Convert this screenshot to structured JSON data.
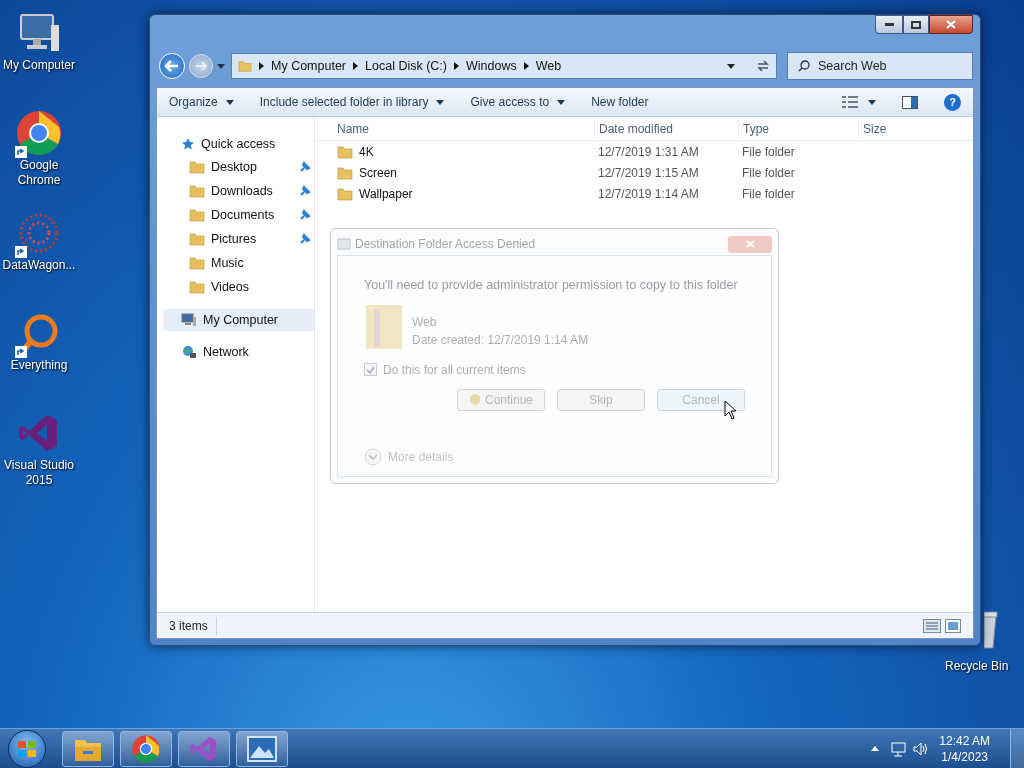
{
  "desktop_icons": [
    {
      "label": "My Computer",
      "kind": "computer",
      "shortcut": false
    },
    {
      "label": "Google Chrome",
      "kind": "chrome",
      "shortcut": true
    },
    {
      "label": "DataWagon...",
      "kind": "datawagon",
      "shortcut": true
    },
    {
      "label": "Everything",
      "kind": "everything",
      "shortcut": true
    },
    {
      "label": "Visual Studio 2015",
      "kind": "vs",
      "shortcut": false
    }
  ],
  "recycle_bin": {
    "label": "Recycle Bin"
  },
  "explorer": {
    "breadcrumb": [
      "My Computer",
      "Local Disk (C:)",
      "Windows",
      "Web"
    ],
    "search": {
      "placeholder": "Search Web"
    },
    "toolbar": [
      {
        "label": "Organize",
        "dropdown": true
      },
      {
        "label": "Include selected folder in library",
        "dropdown": true
      },
      {
        "label": "Give access to",
        "dropdown": true
      },
      {
        "label": "New folder",
        "dropdown": false
      }
    ],
    "nav": [
      {
        "label": "Quick access",
        "kind": "star",
        "selected": false,
        "children": [
          {
            "label": "Desktop",
            "pinned": true
          },
          {
            "label": "Downloads",
            "pinned": true
          },
          {
            "label": "Documents",
            "pinned": true
          },
          {
            "label": "Pictures",
            "pinned": true
          },
          {
            "label": "Music",
            "pinned": false
          },
          {
            "label": "Videos",
            "pinned": false
          }
        ]
      },
      {
        "label": "My Computer",
        "kind": "computer",
        "selected": true
      },
      {
        "label": "Network",
        "kind": "network",
        "selected": false
      }
    ],
    "columns": [
      "Name",
      "Date modified",
      "Type",
      "Size"
    ],
    "rows": [
      {
        "name": "4K",
        "date": "12/7/2019 1:31 AM",
        "type": "File folder"
      },
      {
        "name": "Screen",
        "date": "12/7/2019 1:15 AM",
        "type": "File folder"
      },
      {
        "name": "Wallpaper",
        "date": "12/7/2019 1:14 AM",
        "type": "File folder"
      }
    ],
    "status": "3 items",
    "help": "?"
  },
  "dialog": {
    "title": "Destination Folder Access Denied",
    "message": "You'll need to provide administrator permission to copy to this folder",
    "item_name": "Web",
    "item_detail": "Date created: 12/7/2019 1:14 AM",
    "checkbox": {
      "label": "Do this for all current items",
      "checked": true
    },
    "buttons": [
      {
        "label": "Continue",
        "shield": true
      },
      {
        "label": "Skip",
        "shield": false
      },
      {
        "label": "Cancel",
        "shield": false
      }
    ],
    "more_details": "More details"
  },
  "taskbar": {
    "items": [
      {
        "kind": "explorer"
      },
      {
        "kind": "chrome"
      },
      {
        "kind": "vs"
      },
      {
        "kind": "photos"
      }
    ],
    "time": "12:42 AM",
    "date": "1/4/2023"
  }
}
